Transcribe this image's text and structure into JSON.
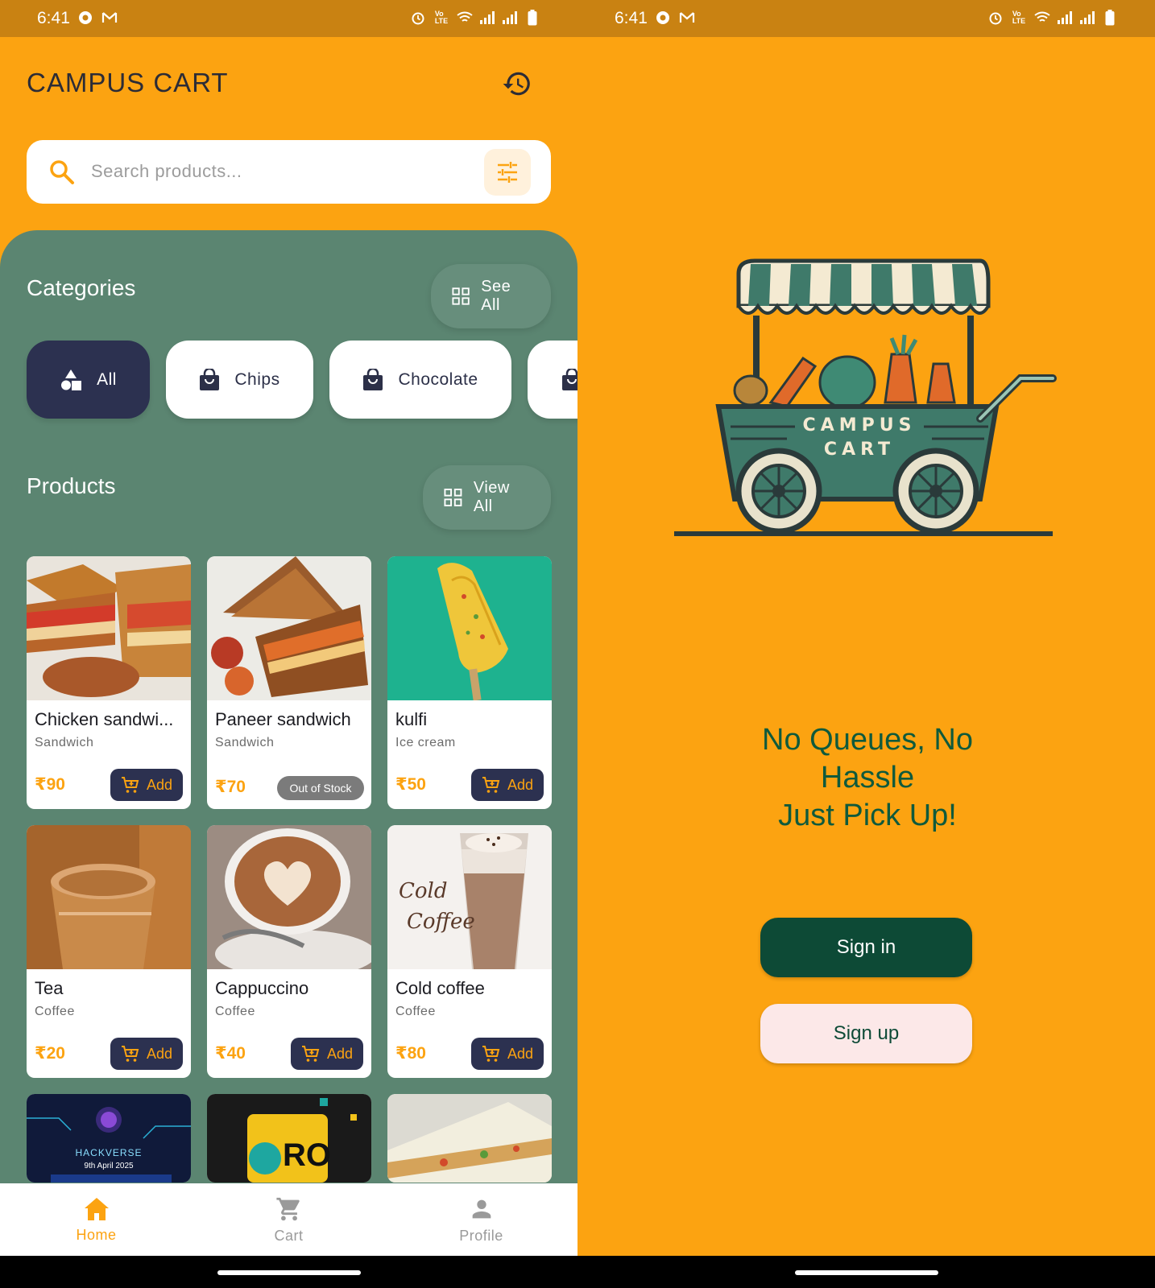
{
  "status_bar": {
    "time": "6:41"
  },
  "home": {
    "app_title": "CAMPUS CART",
    "search": {
      "placeholder": "Search products..."
    },
    "categories": {
      "title": "Categories",
      "see_all_label": "See All",
      "items": [
        {
          "label": "All",
          "active": true
        },
        {
          "label": "Chips",
          "active": false
        },
        {
          "label": "Chocolate",
          "active": false
        }
      ]
    },
    "products": {
      "title": "Products",
      "view_all_label": "View All",
      "items": [
        {
          "name": "Chicken sandwi...",
          "category": "Sandwich",
          "price": "₹90",
          "action": "Add"
        },
        {
          "name": "Paneer sandwich",
          "category": "Sandwich",
          "price": "₹70",
          "status": "Out of Stock"
        },
        {
          "name": "kulfi",
          "category": "Ice cream",
          "price": "₹50",
          "action": "Add"
        },
        {
          "name": "Tea",
          "category": "Coffee",
          "price": "₹20",
          "action": "Add"
        },
        {
          "name": "Cappuccino",
          "category": "Coffee",
          "price": "₹40",
          "action": "Add"
        },
        {
          "name": "Cold coffee",
          "category": "Coffee",
          "price": "₹80",
          "action": "Add"
        }
      ],
      "partial_images": {
        "poster_title": "HACKVERSE",
        "poster_date": "9th April 2025",
        "can_label": "RO"
      }
    },
    "bottom_nav": [
      {
        "label": "Home",
        "icon": "home-icon",
        "active": true
      },
      {
        "label": "Cart",
        "icon": "cart-icon",
        "active": false
      },
      {
        "label": "Profile",
        "icon": "person-icon",
        "active": false
      }
    ]
  },
  "welcome": {
    "logo_text_top": "CAMPUS",
    "logo_text_bottom": "CART",
    "tagline_line1": "No Queues, No",
    "tagline_line2": "Hassle",
    "tagline_line3": "Just Pick Up!",
    "signin_label": "Sign in",
    "signup_label": "Sign up"
  },
  "colors": {
    "primary": "#FCA311",
    "panel": "#5B8571",
    "navy": "#2C3150",
    "dark_green": "#0D4A36",
    "status_bar": "#C98212"
  }
}
